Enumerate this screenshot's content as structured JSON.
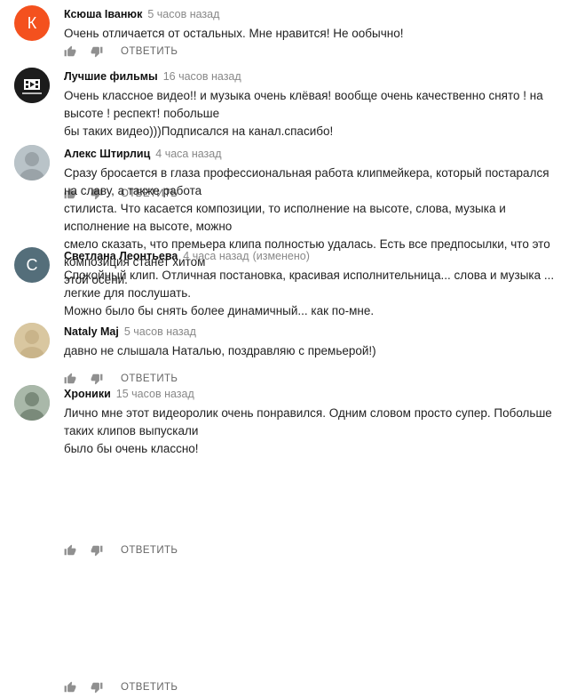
{
  "comments": [
    {
      "author": "Ксюша Іванюк",
      "time": "5 часов назад",
      "edited": "",
      "avatar_letter": "К",
      "avatar_color": "#f4511e",
      "avatar_icon": "letter-avatar",
      "text": "Очень отличается от остальных. Мне нравится! Не ообычно!",
      "reply_label": "ОТВЕТИТЬ"
    },
    {
      "author": "Лучшие фильмы",
      "time": "16 часов назад",
      "edited": "",
      "avatar_letter": "",
      "avatar_color": "#222222",
      "avatar_icon": "film-logo-avatar",
      "text": "Очень классное видео!! и музыка очень клёвая! вообще очень качественно снято ! на высоте ! респект! побольше\nбы таких видео)))Подписался на канал.спасибо!",
      "reply_label": "ОТВЕТИТЬ"
    },
    {
      "author": "Алекс Штирлиц",
      "time": "4 часа назад",
      "edited": "",
      "avatar_letter": "",
      "avatar_color": "#9aa3a8",
      "avatar_icon": "user-photo-avatar",
      "text": "Сразу бросается в глаза профессиональная работа клипмейкера, который постарался на славу, а также работа\nстилиста. Что касается композиции, то исполнение на высоте, слова, музыка и исполнение на высоте, можно\nсмело сказать, что премьера клипа полностью удалась. Есть все предпосылки, что это композиция станет хитом\nэтой осени.",
      "reply_label": "ОТВЕТИТЬ"
    },
    {
      "author": "Светлана Леонтьева",
      "time": "4 часа назад",
      "edited": "(изменено)",
      "avatar_letter": "С",
      "avatar_color": "#546e7a",
      "avatar_icon": "letter-avatar",
      "text": "Спокойный клип. Отличная постановка, красивая исполнительница... слова и музыка ... легкие для послушать.\nМожно было бы снять более динамичный... как по-мне.",
      "reply_label": "ОТВЕТИТЬ"
    },
    {
      "author": "Nataly Maj",
      "time": "5 часов назад",
      "edited": "",
      "avatar_letter": "",
      "avatar_color": "#c9b48a",
      "avatar_icon": "user-photo-avatar",
      "text": "давно не слышала Наталью, поздравляю с премьерой!)",
      "reply_label": "ОТВЕТИТЬ"
    },
    {
      "author": "Хроники",
      "time": "15 часов назад",
      "edited": "",
      "avatar_letter": "",
      "avatar_color": "#7a8a7a",
      "avatar_icon": "user-photo-avatar",
      "text": "Лично мне этот видеоролик очень понравился. Одним словом просто супер. Побольше таких клипов выпускали\nбыло бы очень классно!",
      "reply_label": ""
    }
  ],
  "icons": {
    "like": "thumbs-up-icon",
    "dislike": "thumbs-down-icon",
    "icon_color": "#909090"
  }
}
